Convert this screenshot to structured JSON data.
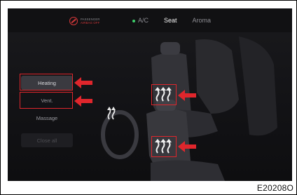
{
  "airbag": {
    "line1": "PASSENGER",
    "line2": "AIRBAG",
    "status": "OFF"
  },
  "tabs": [
    {
      "label": "A/C",
      "active": false,
      "indicator": "green-dot"
    },
    {
      "label": "Seat",
      "active": true
    },
    {
      "label": "Aroma",
      "active": false
    }
  ],
  "menu": {
    "heating": "Heating",
    "vent": "Vent.",
    "massage": "Massage",
    "close_all": "Close all"
  },
  "figure_code": "E20208O",
  "colors": {
    "callout_red": "#e0262c",
    "indicator_green": "#3ecf6a"
  }
}
